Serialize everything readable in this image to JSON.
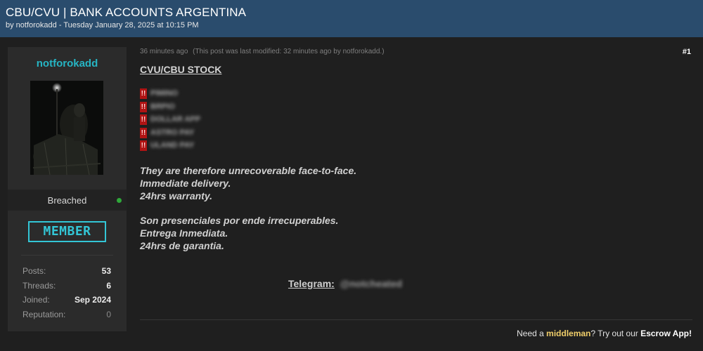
{
  "thread": {
    "title": "CBU/CVU | BANK ACCOUNTS ARGENTINA",
    "byline": "by notforokadd - Tuesday January 28, 2025 at 10:15 PM"
  },
  "user": {
    "username": "notforokadd",
    "usergroup": "Breached",
    "rank": "MEMBER",
    "stats": [
      {
        "label": "Posts:",
        "value": "53"
      },
      {
        "label": "Threads:",
        "value": "6"
      },
      {
        "label": "Joined:",
        "value": "Sep 2024"
      },
      {
        "label": "Reputation:",
        "value": "0"
      }
    ]
  },
  "post": {
    "time": "36 minutes ago",
    "edited": "(This post was last modified: 32 minutes ago by notforokadd.)",
    "number": "#1",
    "heading": "CVU/CBU STOCK",
    "stock_items": [
      "PIMINO",
      "BRPIO",
      "DOLLAR APP",
      "ASTRO PAY",
      "ULAND PAY"
    ],
    "bang": "!!",
    "english_lines": [
      "They are therefore unrecoverable face-to-face.",
      "Immediate delivery.",
      "24hrs warranty."
    ],
    "spanish_lines": [
      "Son presenciales por ende irrecuperables.",
      "Entrega Inmediata.",
      "24hrs de garantia."
    ],
    "telegram_label": "Telegram:",
    "telegram_handle": "@notcheated"
  },
  "footer": {
    "prefix": "Need a ",
    "middleman": "middleman",
    "middle": "? Try out our ",
    "escrow": "Escrow App!"
  },
  "colors": {
    "header_bg": "#2a4c6d",
    "username": "#26b5c4",
    "rank_badge": "#33c6d6",
    "online": "#2fa83a",
    "alert": "#b01414",
    "highlight": "#f0ce6a"
  }
}
